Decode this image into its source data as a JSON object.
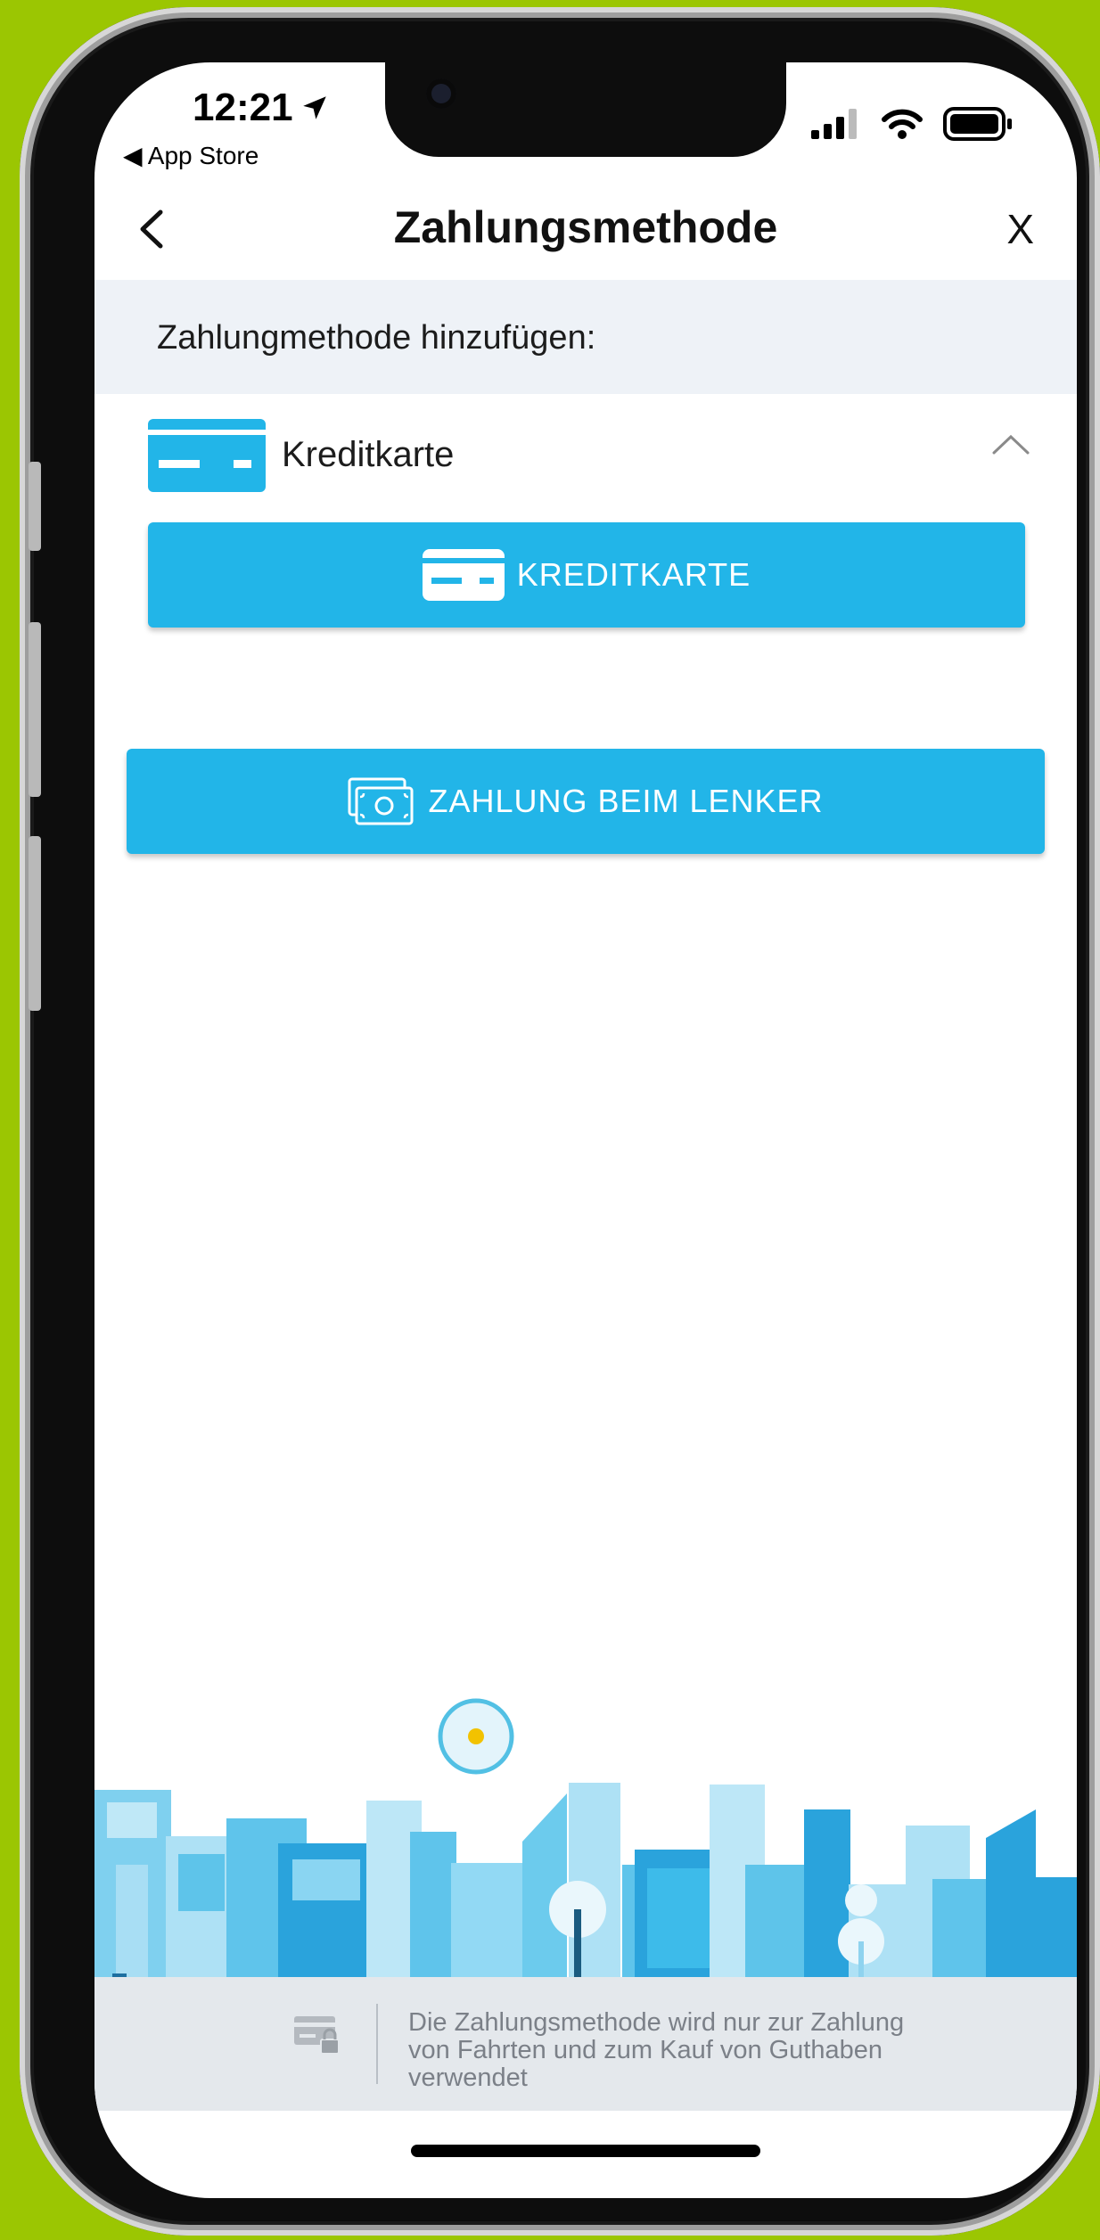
{
  "status_bar": {
    "time": "12:21",
    "back_to_app": "◀ App Store"
  },
  "header": {
    "title": "Zahlungsmethode",
    "close_label": "X"
  },
  "section": {
    "heading": "Zahlungmethode hinzufügen:"
  },
  "payment_method": {
    "label": "Kreditkarte",
    "button_label": "KREDITKARTE"
  },
  "cash_button": {
    "label": "ZAHLUNG BEIM LENKER"
  },
  "footer": {
    "note": "Die Zahlungsmethode wird nur zur Zahlung von Fahrten und zum Kauf von Guthaben verwendet"
  },
  "colors": {
    "accent": "#22b5e8",
    "background": "#9bc602",
    "section_bg": "#eef2f7"
  }
}
